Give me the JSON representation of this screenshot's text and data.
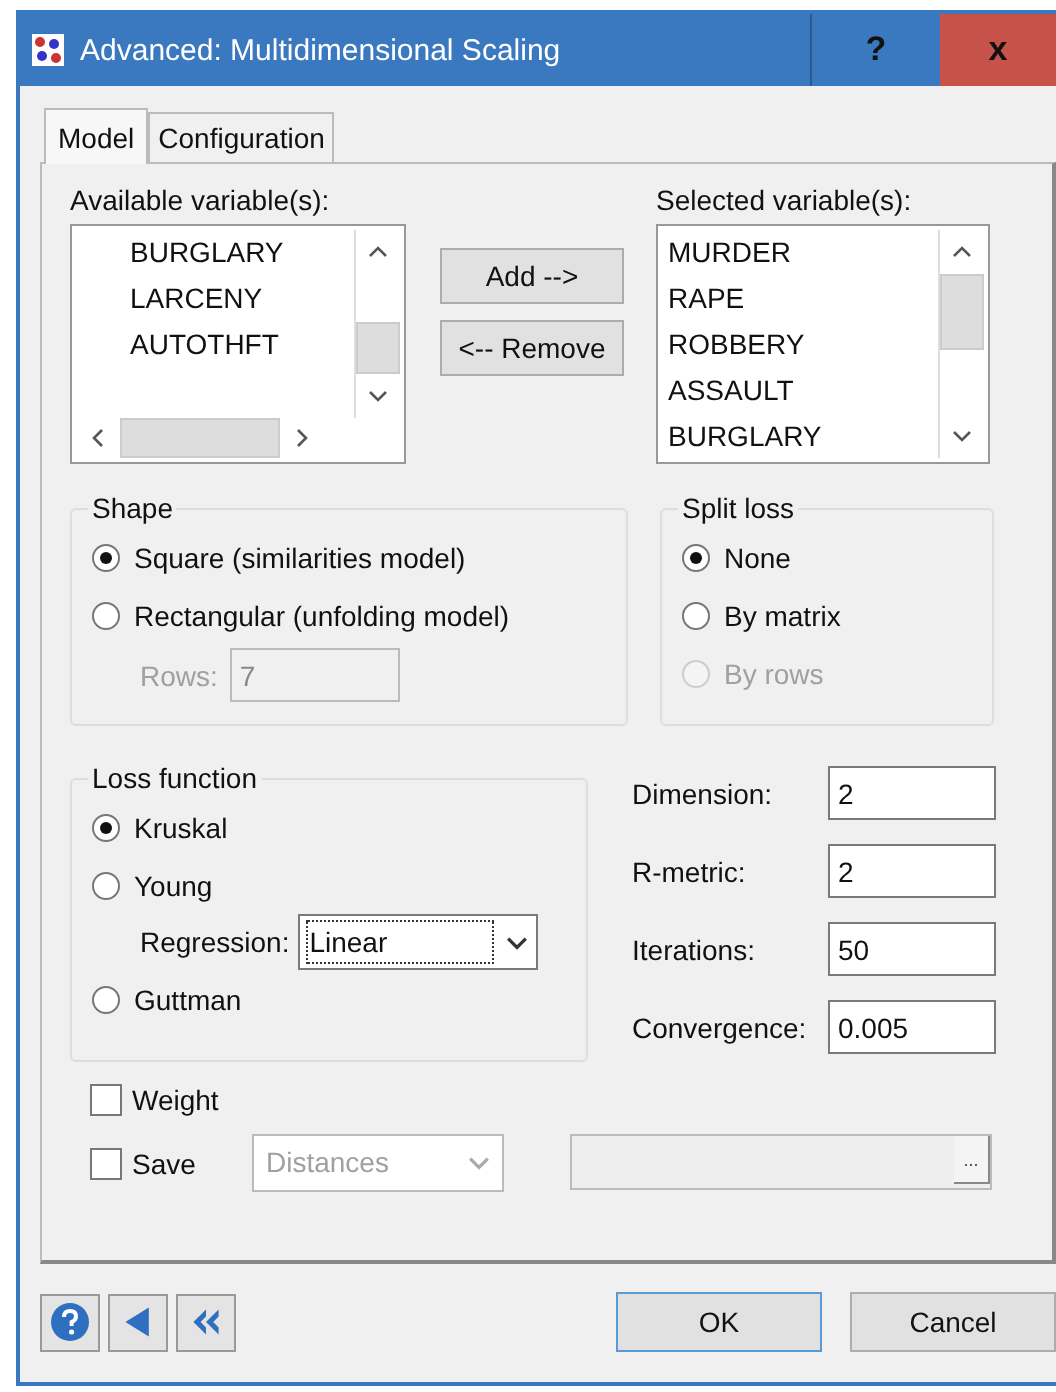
{
  "window": {
    "title": "Advanced: Multidimensional Scaling",
    "help_button": "?",
    "close_button": "x"
  },
  "tabs": [
    {
      "label": "Model",
      "selected": true
    },
    {
      "label": "Configuration",
      "selected": false
    }
  ],
  "available": {
    "label": "Available variable(s):",
    "items": [
      "BURGLARY",
      "LARCENY",
      "AUTOTHFT"
    ]
  },
  "add_button": "Add -->",
  "remove_button": "<-- Remove",
  "selected": {
    "label": "Selected variable(s):",
    "items": [
      "MURDER",
      "RAPE",
      "ROBBERY",
      "ASSAULT",
      "BURGLARY"
    ]
  },
  "shape": {
    "title": "Shape",
    "options": [
      {
        "label": "Square (similarities model)",
        "selected": true
      },
      {
        "label": "Rectangular (unfolding model)",
        "selected": false
      }
    ],
    "rows": {
      "label": "Rows:",
      "value": "7",
      "disabled": true
    }
  },
  "split_loss": {
    "title": "Split loss",
    "options": [
      {
        "label": "None",
        "selected": true,
        "disabled": false
      },
      {
        "label": "By matrix",
        "selected": false,
        "disabled": false
      },
      {
        "label": "By rows",
        "selected": false,
        "disabled": true
      }
    ]
  },
  "loss_function": {
    "title": "Loss function",
    "options": [
      {
        "label": "Kruskal",
        "selected": true
      },
      {
        "label": "Young",
        "selected": false
      },
      {
        "label": "Guttman",
        "selected": false
      }
    ],
    "regression": {
      "label": "Regression:",
      "value": "Linear"
    }
  },
  "params": [
    {
      "label": "Dimension:",
      "value": "2"
    },
    {
      "label": "R-metric:",
      "value": "2"
    },
    {
      "label": "Iterations:",
      "value": "50"
    },
    {
      "label": "Convergence:",
      "value": "0.005"
    }
  ],
  "weight": {
    "label": "Weight",
    "checked": false
  },
  "save": {
    "label": "Save",
    "checked": false,
    "type": {
      "value": "Distances",
      "disabled": true
    },
    "browse": "..."
  },
  "buttons": {
    "ok": "OK",
    "cancel": "Cancel"
  }
}
